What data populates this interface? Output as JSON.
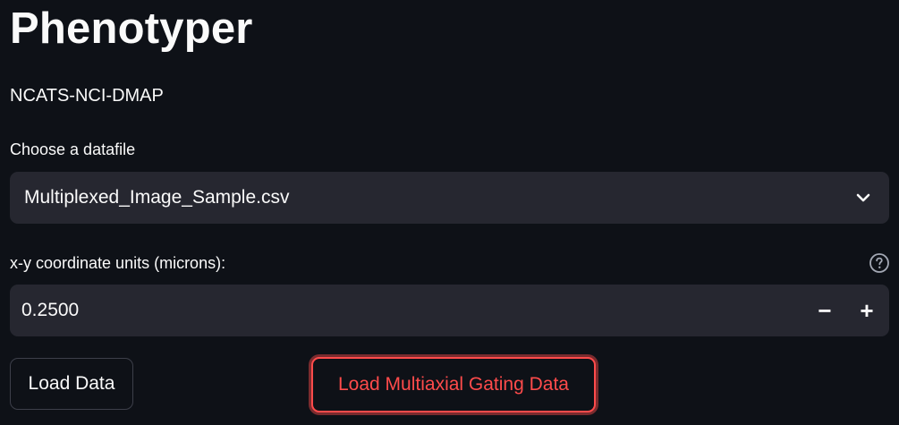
{
  "app": {
    "title": "Phenotyper",
    "subtitle": "NCATS-NCI-DMAP"
  },
  "datafile": {
    "label": "Choose a datafile",
    "selected": "Multiplexed_Image_Sample.csv",
    "icon": "chevron-down-icon"
  },
  "units": {
    "label": "x-y coordinate units (microns):",
    "value": "0.2500",
    "help_icon": "help-circle-icon",
    "decrement_label": "−",
    "increment_label": "+"
  },
  "buttons": {
    "load_data": "Load Data",
    "load_gating": "Load Multiaxial Gating Data"
  },
  "colors": {
    "background": "#0e1117",
    "widget_bg": "#262730",
    "text": "#fafafa",
    "accent": "#ff4b4b"
  }
}
